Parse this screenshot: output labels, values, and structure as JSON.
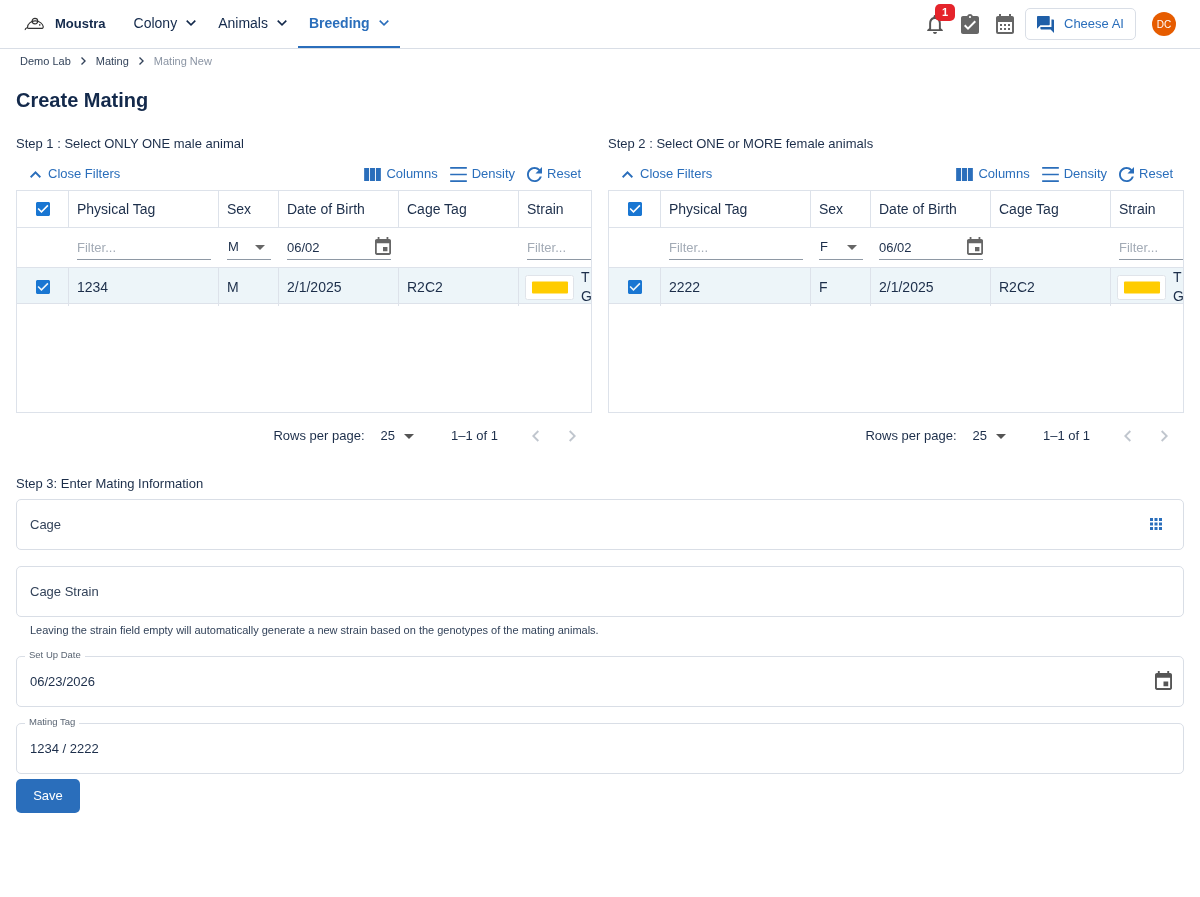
{
  "header": {
    "app_name": "Moustra",
    "nav": [
      {
        "label": "Colony",
        "selected": false
      },
      {
        "label": "Animals",
        "selected": false
      },
      {
        "label": "Breeding",
        "selected": true
      }
    ],
    "notification_count": "1",
    "assistant_button": "Cheese AI",
    "avatar_initials": "DC"
  },
  "breadcrumb": [
    {
      "label": "Demo Lab",
      "current": false
    },
    {
      "label": "Mating",
      "current": false
    },
    {
      "label": "Mating New",
      "current": true
    }
  ],
  "page_title": "Create Mating",
  "tables": [
    {
      "label": "Step 1 : Select ONLY ONE male animal",
      "toolbar": {
        "filter_toggle": "Close Filters",
        "actions": [
          {
            "kind": "columns",
            "label": "Columns"
          },
          {
            "kind": "density",
            "label": "Density"
          },
          {
            "kind": "reset",
            "label": "Reset"
          }
        ]
      },
      "select_all_checked": true,
      "columns": [
        {
          "label": "Physical Tag",
          "filter": {
            "kind": "text",
            "placeholder": "Filter..."
          }
        },
        {
          "label": "Sex",
          "filter": {
            "kind": "select",
            "value": "M"
          }
        },
        {
          "label": "Date of Birth",
          "filter": {
            "kind": "date",
            "value": "06/02"
          }
        },
        {
          "label": "Cage Tag"
        },
        {
          "label": "Strain",
          "filter": {
            "kind": "text",
            "placeholder": "Filter..."
          }
        }
      ],
      "rows": [
        {
          "selected": true,
          "cells": [
            "1234",
            "M",
            "2/1/2025",
            "R2C2"
          ],
          "strain": {
            "color": "#ffcc00",
            "lines": [
              "T",
              "G"
            ]
          }
        }
      ],
      "pagination": {
        "rows_per_page_label": "Rows per page:",
        "rows_per_page": "25",
        "range": "1–1 of 1",
        "prev_disabled": true,
        "next_disabled": true
      }
    },
    {
      "label": "Step 2 : Select ONE or MORE female animals",
      "toolbar": {
        "filter_toggle": "Close Filters",
        "actions": [
          {
            "kind": "columns",
            "label": "Columns"
          },
          {
            "kind": "density",
            "label": "Density"
          },
          {
            "kind": "reset",
            "label": "Reset"
          }
        ]
      },
      "select_all_checked": true,
      "columns": [
        {
          "label": "Physical Tag",
          "filter": {
            "kind": "text",
            "placeholder": "Filter..."
          }
        },
        {
          "label": "Sex",
          "filter": {
            "kind": "select",
            "value": "F"
          }
        },
        {
          "label": "Date of Birth",
          "filter": {
            "kind": "date",
            "value": "06/02"
          }
        },
        {
          "label": "Cage Tag"
        },
        {
          "label": "Strain",
          "filter": {
            "kind": "text",
            "placeholder": "Filter..."
          }
        }
      ],
      "rows": [
        {
          "selected": true,
          "cells": [
            "2222",
            "F",
            "2/1/2025",
            "R2C2"
          ],
          "strain": {
            "color": "#ffcc00",
            "lines": [
              "T",
              "G"
            ]
          }
        }
      ],
      "pagination": {
        "rows_per_page_label": "Rows per page:",
        "rows_per_page": "25",
        "range": "1–1 of 1",
        "prev_disabled": true,
        "next_disabled": true
      }
    }
  ],
  "form": {
    "label": "Step 3: Enter Mating Information",
    "fields": [
      {
        "kind": "picker",
        "placeholder": "Cage"
      },
      {
        "kind": "text",
        "placeholder": "Cage Strain",
        "helper": "Leaving the strain field empty will automatically generate a new strain based on the genotypes of the mating animals."
      },
      {
        "kind": "date",
        "label": "Set Up Date",
        "value": "06/23/2026"
      },
      {
        "kind": "text",
        "label": "Mating Tag",
        "value": "1234 / 2222"
      }
    ],
    "submit": "Save"
  }
}
